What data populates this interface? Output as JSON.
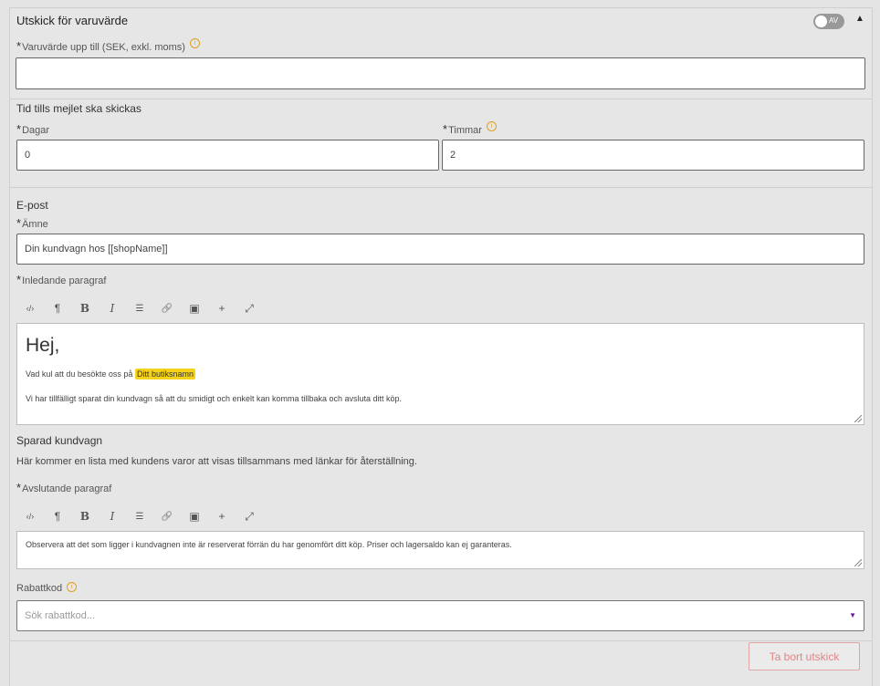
{
  "header": {
    "title": "Utskick för varuvärde",
    "toggle_label": "AV",
    "collapse_icon": "triangle-up"
  },
  "required_mark": "*",
  "info_glyph": "i",
  "value_field": {
    "label": "Varuvärde upp till (SEK, exkl. moms)",
    "value": ""
  },
  "timing": {
    "title": "Tid tills mejlet ska skickas",
    "days_label": "Dagar",
    "days_value": "0",
    "hours_label": "Timmar",
    "hours_value": "2"
  },
  "email": {
    "title": "E-post",
    "subject_label": "Ämne",
    "subject_value": "Din kundvagn hos [[shopName]]",
    "intro_label": "Inledande paragraf",
    "intro": {
      "heading": "Hej,",
      "line1_prefix": "Vad kul att du besökte oss på",
      "line1_tag": "Ditt butiksnamn",
      "line2": "Vi har tillfälligt sparat din kundvagn så att du smidigt och enkelt kan komma tillbaka och avsluta ditt köp."
    },
    "saved_cart_title": "Sparad kundvagn",
    "saved_cart_desc": "Här kommer en lista med kundens varor att visas tillsammans med länkar för återställning.",
    "closing_label": "Avslutande paragraf",
    "closing_text": "Observera att det som ligger i kundvagnen inte är reserverat förrän du har genomfört ditt köp. Priser och lagersaldo kan ej garanteras.",
    "toolbar": {
      "code": "‹/›",
      "paragraph": "¶",
      "bold": "B",
      "italic": "I",
      "list": "☰",
      "link": "🔗",
      "image": "▣",
      "plus": "+",
      "expand": "⤢"
    }
  },
  "discount": {
    "label": "Rabattkod",
    "placeholder": "Sök rabattkod..."
  },
  "delete_button": "Ta bort utskick",
  "colors": {
    "panel_bg": "#e6e6e6",
    "highlight": "#f5d31a",
    "delete_text": "#e08585",
    "info": "#e0a020",
    "dropdown_arrow": "#6a1b9a"
  }
}
